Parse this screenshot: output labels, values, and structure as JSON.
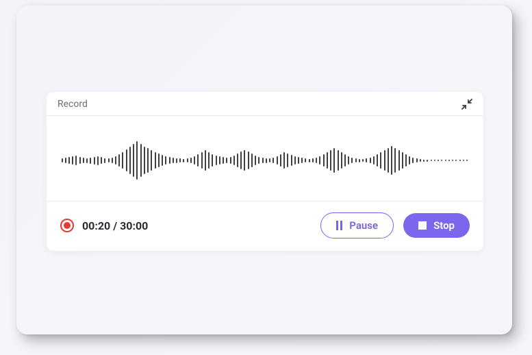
{
  "card": {
    "title": "Record"
  },
  "time": {
    "formatted": "00:20 / 30:00",
    "current": "00:20",
    "total": "30:00"
  },
  "buttons": {
    "pause": "Pause",
    "stop": "Stop"
  },
  "icons": {
    "collapse": "collapse-icon",
    "record": "record-indicator",
    "pause": "pause-icon",
    "stop": "stop-icon"
  },
  "colors": {
    "accent": "#7b66ec",
    "recording": "#e53935",
    "text": "#2b2d34",
    "wave": "#3d3f47"
  },
  "waveform": {
    "bars": [
      6,
      8,
      10,
      12,
      14,
      10,
      8,
      7,
      9,
      11,
      13,
      10,
      7,
      6,
      8,
      12,
      18,
      24,
      32,
      40,
      48,
      56,
      48,
      40,
      36,
      30,
      24,
      20,
      16,
      12,
      10,
      8,
      7,
      6,
      5,
      6,
      8,
      12,
      18,
      24,
      30,
      24,
      18,
      14,
      12,
      10,
      8,
      10,
      14,
      20,
      26,
      30,
      26,
      20,
      14,
      10,
      8,
      7,
      6,
      8,
      12,
      18,
      24,
      20,
      16,
      12,
      10,
      8,
      6,
      5,
      6,
      8,
      12,
      18,
      24,
      30,
      36,
      30,
      24,
      18,
      12,
      8,
      6,
      5,
      4,
      6,
      8,
      12,
      18,
      24,
      30,
      36,
      42,
      36,
      30,
      24,
      18,
      12,
      8,
      6,
      4,
      3,
      3,
      2,
      2,
      2,
      2,
      2,
      2,
      2,
      2,
      2,
      2,
      2
    ]
  }
}
